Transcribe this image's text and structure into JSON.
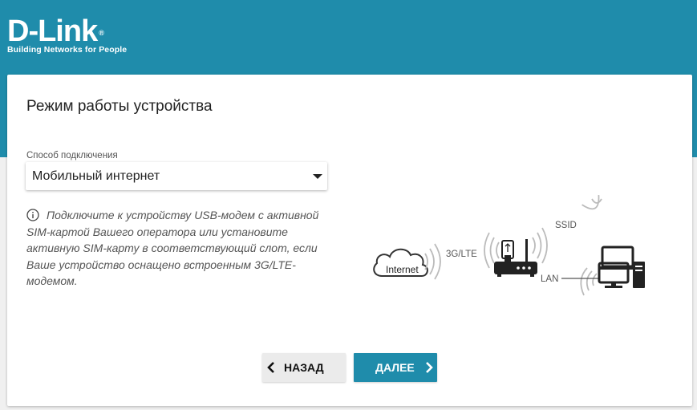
{
  "logo": {
    "text": "D-Link",
    "registered": "®",
    "tagline": "Building Networks for People"
  },
  "page": {
    "title": "Режим работы устройства"
  },
  "connection": {
    "label": "Способ подключения",
    "value": "Мобильный интернет"
  },
  "info": {
    "text": "Подключите к устройству USB-модем с активной SIM-картой Вашего оператора или установите активную SIM-карту в соответствующий слот, если Ваше устройство оснащено встроенным 3G/LTE-модемом."
  },
  "diagram": {
    "internet_label": "Internet",
    "mobile_label": "3G/LTE",
    "wifi_label": "SSID",
    "lan_label": "LAN"
  },
  "buttons": {
    "back": "НАЗАД",
    "next": "ДАЛЕЕ"
  },
  "colors": {
    "brand": "#1f8cab",
    "background": "#f0f0f0"
  }
}
